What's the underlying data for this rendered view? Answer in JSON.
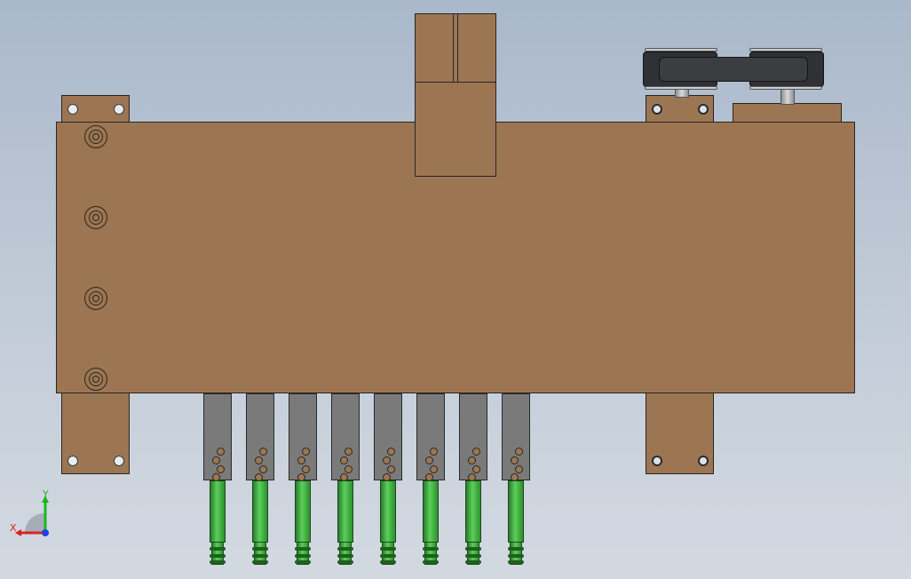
{
  "viewport": {
    "background_top": "#a9b8cb",
    "background_bottom": "#d3d9e1",
    "part_color": "#9c7653",
    "finger_color": "#7a7a7a",
    "rod_color": "#4cc34c"
  },
  "triad": {
    "x_label": "X",
    "y_label": "Y",
    "x_color": "#e02020",
    "y_color": "#1fb51f",
    "z_color": "#2040e0"
  },
  "gripper_count": 8
}
